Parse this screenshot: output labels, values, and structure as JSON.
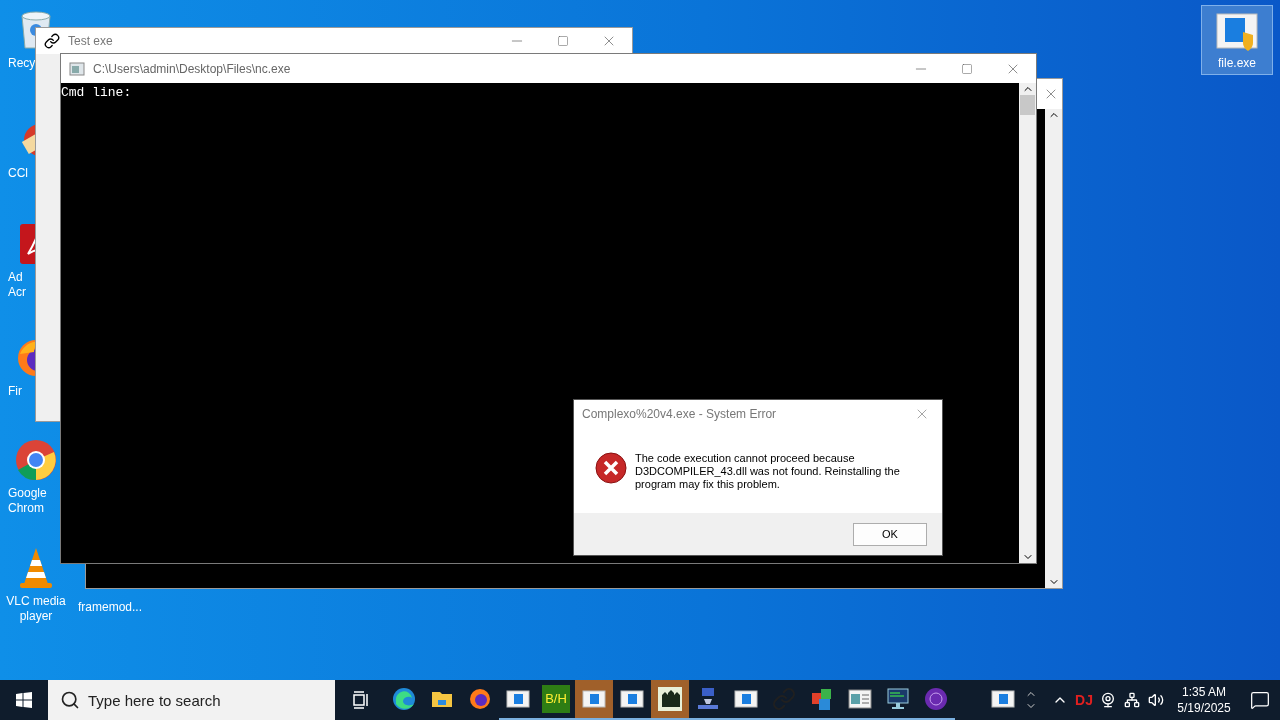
{
  "desktop_icons": [
    {
      "kind": "recycle-bin",
      "label": [
        "Recy"
      ]
    },
    {
      "kind": "ccleaner",
      "label": [
        "CCl"
      ]
    },
    {
      "kind": "acrobat",
      "label": [
        "Ad",
        "Acr"
      ]
    },
    {
      "kind": "firefox",
      "label": [
        "Fir"
      ]
    },
    {
      "kind": "chrome",
      "label": [
        "Google",
        "Chrom"
      ]
    },
    {
      "kind": "vlc",
      "label": [
        "VLC media",
        "player"
      ]
    }
  ],
  "partial_icon": {
    "label": "framemod..."
  },
  "file_icon": {
    "label": "file.exe",
    "selected": true
  },
  "test_window": {
    "title": "Test exe"
  },
  "console_window": {
    "title": "C:\\Users\\admin\\Desktop\\Files\\nc.exe",
    "text": "Cmd line:"
  },
  "dialog": {
    "title": "Complexo%20v4.exe - System Error",
    "message": "The code execution cannot proceed because D3DCOMPILER_43.dll was not found. Reinstalling the program may fix this problem.",
    "button": "OK"
  },
  "taskbar": {
    "search": {
      "placeholder": "Type here to search"
    },
    "apps": [
      {
        "kind": "edge",
        "running": false,
        "selected": false
      },
      {
        "kind": "folder",
        "running": false,
        "selected": false
      },
      {
        "kind": "firefox",
        "running": false,
        "selected": false
      },
      {
        "kind": "window",
        "running": true,
        "selected": false
      },
      {
        "kind": "tile",
        "text": "B/H",
        "running": true,
        "selected": false
      },
      {
        "kind": "window",
        "running": true,
        "selected": true
      },
      {
        "kind": "window",
        "running": true,
        "selected": false
      },
      {
        "kind": "figures",
        "running": true,
        "selected": true
      },
      {
        "kind": "setup",
        "running": true,
        "selected": false
      },
      {
        "kind": "window",
        "running": true,
        "selected": false
      },
      {
        "kind": "link",
        "running": true,
        "selected": false
      },
      {
        "kind": "cubes",
        "running": true,
        "selected": false
      },
      {
        "kind": "form",
        "running": true,
        "selected": false
      },
      {
        "kind": "monitor",
        "running": true,
        "selected": false
      },
      {
        "kind": "disc",
        "running": true,
        "selected": false
      }
    ],
    "overflow_app": {
      "kind": "window",
      "running": false,
      "selected": false
    },
    "tray_badge": "DJ",
    "time": "1:35 AM",
    "date": "5/19/2025"
  }
}
